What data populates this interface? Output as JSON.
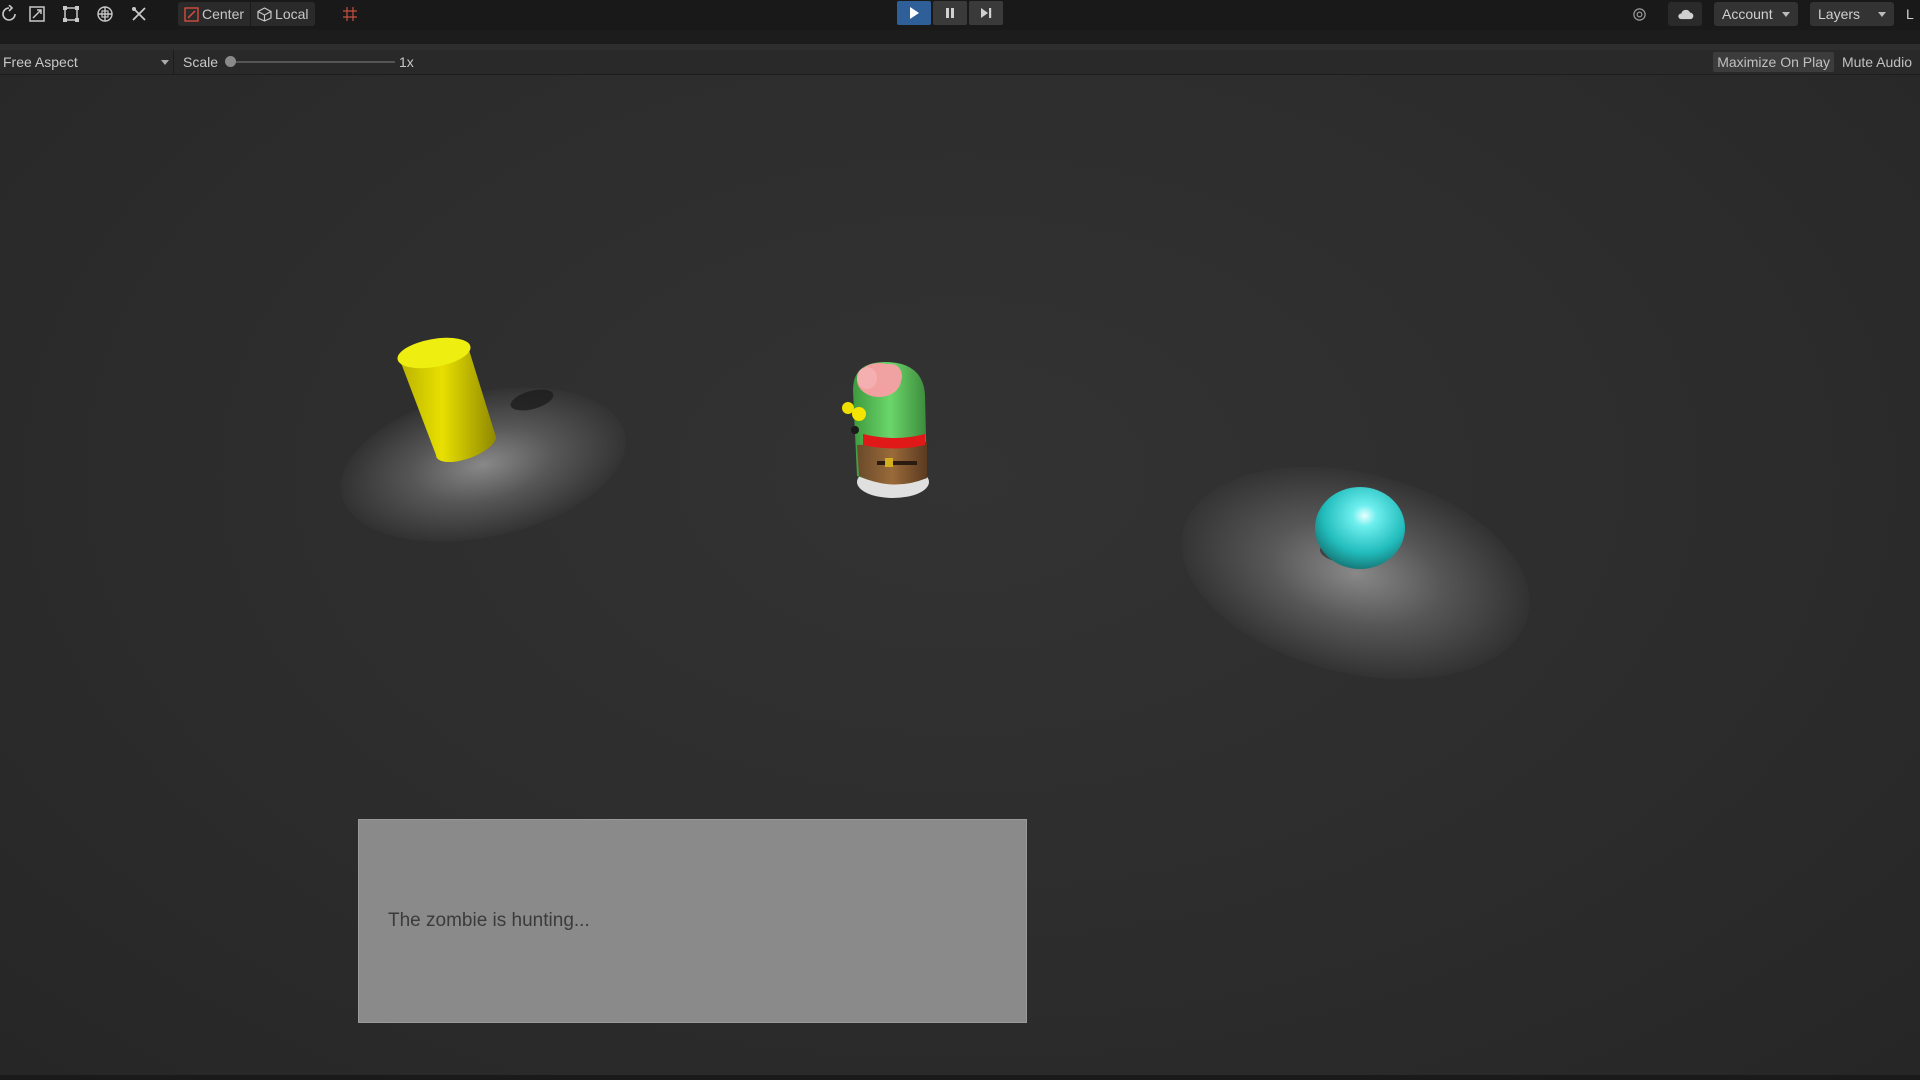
{
  "toolbar": {
    "tools": [
      {
        "name": "rotate-tool-icon"
      },
      {
        "name": "scale-tool-icon"
      },
      {
        "name": "rect-tool-icon"
      },
      {
        "name": "transform-tool-icon"
      },
      {
        "name": "custom-tool-icon"
      }
    ],
    "pivot_mode_label": "Center",
    "pivot_rotation_label": "Local",
    "snap_icon": "grid-snap-icon",
    "play": {
      "playing": true,
      "play_icon": "play-icon",
      "pause_icon": "pause-icon",
      "step_icon": "step-icon"
    },
    "collab_icon": "collab-icon",
    "cloud_icon": "cloud-icon",
    "account_label": "Account",
    "layers_label": "Layers",
    "layout_label": "L"
  },
  "game_view": {
    "aspect_label": "Free Aspect",
    "scale_label": "Scale",
    "scale_value": "1x",
    "maximize_on_play_label": "Maximize On Play",
    "maximize_on_play_active": true,
    "mute_audio_label": "Mute Audio"
  },
  "scene": {
    "objects": [
      "yellow-cylinder",
      "zombie-character",
      "cyan-sphere"
    ],
    "colors": {
      "cylinder": "#e4dc00",
      "sphere": "#2fd6d6",
      "zombie_body": "#5cc85a",
      "zombie_brain": "#f0a0a0"
    }
  },
  "hud": {
    "status_text": "The zombie is hunting..."
  }
}
